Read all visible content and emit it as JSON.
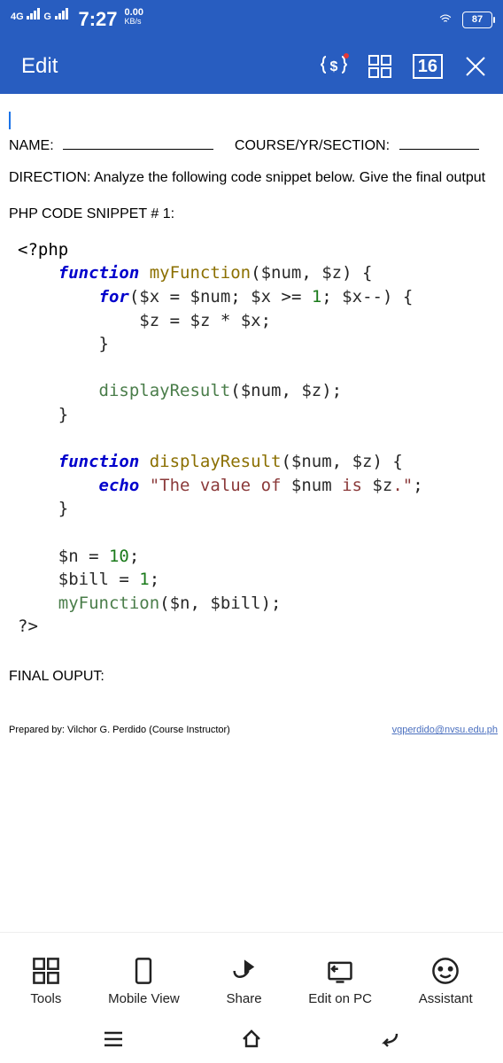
{
  "statusbar": {
    "net1": "4G",
    "net2": "G",
    "time": "7:27",
    "speed_val": "0.00",
    "speed_unit": "KB/s",
    "battery": "87"
  },
  "appbar": {
    "title": "Edit",
    "counter": "16"
  },
  "document": {
    "name_label": "NAME:",
    "course_label": "COURSE/YR/SECTION:",
    "direction": "DIRECTION: Analyze the following code snippet below. Give the final output",
    "snippet_header": "PHP CODE SNIPPET # 1:",
    "code": {
      "open_tag": "<?php",
      "kw_function": "function",
      "fn_my": "myFunction",
      "sig1_open": "(",
      "p_num": "$num",
      "comma": ", ",
      "p_z": "$z",
      "sig1_close": ") {",
      "kw_for": "for",
      "for_open": "(",
      "vx": "$x",
      "eq": " = ",
      "vnum": "$num",
      "semi": "; ",
      "vx2": "$x",
      "gte": " >= ",
      "one": "1",
      "semi2": "; ",
      "vx3": "$x",
      "dec": "--",
      "for_close": ") {",
      "vz": "$z",
      "eq2": " = ",
      "vz2": "$z",
      "star": " * ",
      "vx4": "$x",
      "semi3": ";",
      "brace_c1": "}",
      "call_disp": "displayResult",
      "call_args_open": "(",
      "a_num": "$num",
      "a_comma": ", ",
      "a_z": "$z",
      "call_args_close": ");",
      "brace_c2": "}",
      "fn_disp": "displayResult",
      "sig2_open": "(",
      "sig2_close": ") {",
      "kw_echo": "echo",
      "str1": "\"The value of ",
      "iv1": "$num",
      "str2": " is ",
      "iv2": "$z",
      "str3": ".\"",
      "semi4": ";",
      "brace_c3": "}",
      "vn": "$n",
      "n10": "10",
      "vbill": "$bill",
      "n1": "1",
      "call_my": "myFunction",
      "call_my_open": "(",
      "an": "$n",
      "abill": "$bill",
      "call_my_close": ");",
      "close_tag": "?>"
    },
    "final_label": "FINAL OUPUT:",
    "prepared": "Prepared by: Vilchor G. Perdido (Course Instructor)",
    "email": "vgperdido@nvsu.edu.ph"
  },
  "tabs": {
    "tools": "Tools",
    "mobile": "Mobile View",
    "share": "Share",
    "edit_pc": "Edit on PC",
    "assistant": "Assistant"
  }
}
